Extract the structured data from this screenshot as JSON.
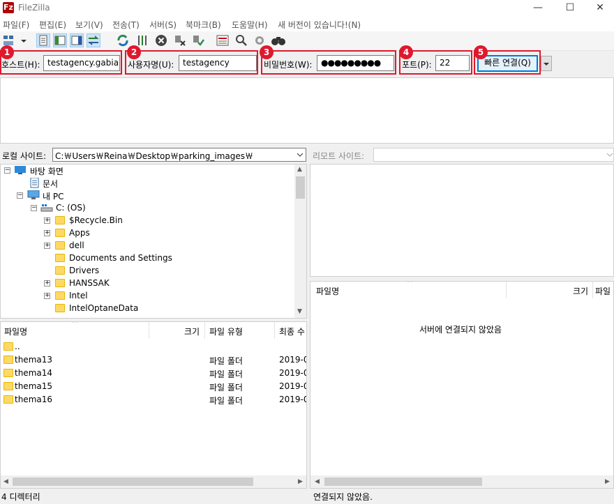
{
  "window": {
    "title": "FileZilla",
    "icon_letter": "Fz",
    "controls": {
      "minimize": "—",
      "maximize": "☐",
      "close": "✕"
    }
  },
  "menu": [
    "파일(F)",
    "편집(E)",
    "보기(V)",
    "전송(T)",
    "서버(S)",
    "북마크(B)",
    "도움말(H)",
    "새 버전이 있습니다!(N)"
  ],
  "quickconnect": {
    "host_label": "호스트(H):",
    "host_value": "testagency.gabia.io",
    "user_label": "사용자명(U):",
    "user_value": "testagency",
    "pass_label": "비밀번호(W):",
    "pass_value": "●●●●●●●●●",
    "port_label": "포트(P):",
    "port_value": "22",
    "connect_button": "빠른 연결(Q)",
    "dropdown_icon": "▼",
    "badges": [
      "1",
      "2",
      "3",
      "4",
      "5"
    ]
  },
  "local": {
    "site_label": "로컬 사이트:",
    "path": "C:￦Users￦Reina￦Desktop￦parking_images￦",
    "tree": [
      {
        "label": "바탕 화면",
        "icon": "desktop-icon"
      },
      {
        "label": "문서",
        "icon": "document-icon"
      },
      {
        "label": "내 PC",
        "icon": "computer-icon"
      },
      {
        "label": "C: (OS)",
        "icon": "drive-icon"
      },
      {
        "label": "$Recycle.Bin",
        "icon": "folder-icon"
      },
      {
        "label": "Apps",
        "icon": "folder-icon"
      },
      {
        "label": "dell",
        "icon": "folder-icon"
      },
      {
        "label": "Documents and Settings",
        "icon": "folder-icon"
      },
      {
        "label": "Drivers",
        "icon": "folder-icon"
      },
      {
        "label": "HANSSAK",
        "icon": "folder-icon"
      },
      {
        "label": "Intel",
        "icon": "folder-icon"
      },
      {
        "label": "IntelOptaneData",
        "icon": "folder-icon"
      }
    ],
    "columns": {
      "name": "파일명",
      "size": "크기",
      "type": "파일 유형",
      "modified": "최종 수"
    },
    "files": [
      {
        "name": "..",
        "type": "",
        "date": ""
      },
      {
        "name": "thema13",
        "type": "파일 폴더",
        "date": "2019-0"
      },
      {
        "name": "thema14",
        "type": "파일 폴더",
        "date": "2019-0"
      },
      {
        "name": "thema15",
        "type": "파일 폴더",
        "date": "2019-0"
      },
      {
        "name": "thema16",
        "type": "파일 폴더",
        "date": "2019-0"
      }
    ],
    "status": "4 디렉터리"
  },
  "remote": {
    "site_label": "리모트 사이트:",
    "columns": {
      "name": "파일명",
      "size": "크기",
      "type": "파일"
    },
    "empty_message": "서버에 연결되지 않았음",
    "status": "연결되지 않았음."
  },
  "colors": {
    "highlight": "#e0182d",
    "accent": "#0078d7",
    "folder": "#ffd966"
  }
}
